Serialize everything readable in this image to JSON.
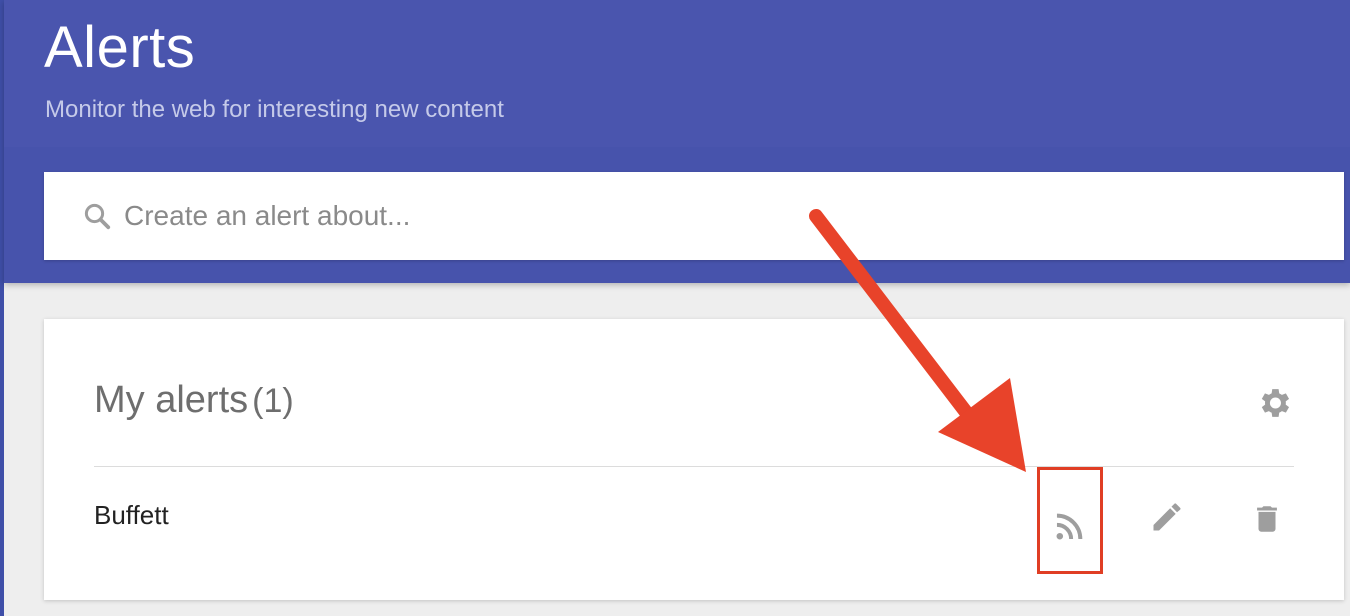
{
  "header": {
    "title": "Alerts",
    "subtitle": "Monitor the web for interesting new content"
  },
  "search": {
    "placeholder": "Create an alert about...",
    "value": "",
    "icon": "search-icon"
  },
  "my_alerts": {
    "title": "My alerts",
    "count": "(1)",
    "settings_icon": "gear-icon",
    "items": [
      {
        "name": "Buffett",
        "actions": [
          "rss-icon",
          "pencil-icon",
          "trash-icon"
        ]
      }
    ]
  },
  "colors": {
    "header_bg": "#4a55ae",
    "annotation": "#e8432a",
    "icon_grey": "#9e9e9e"
  }
}
